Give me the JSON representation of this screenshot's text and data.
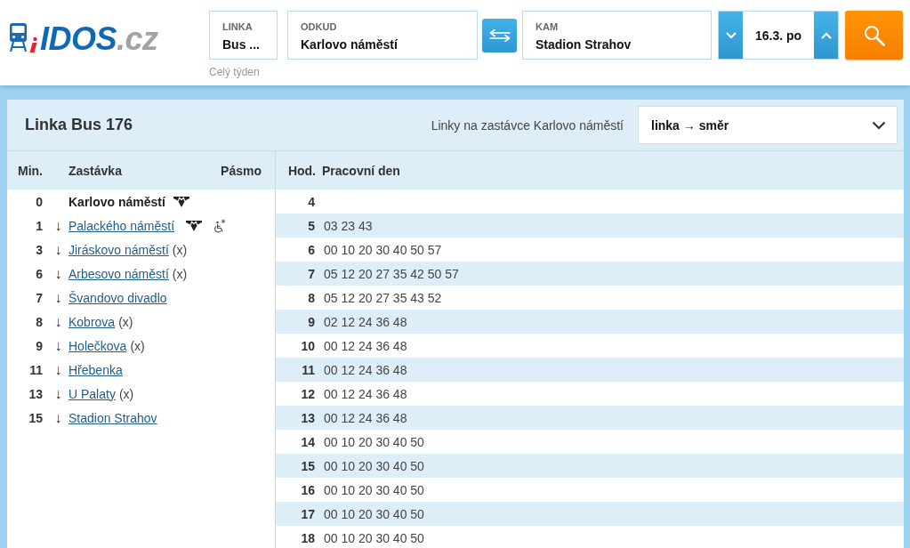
{
  "logo": {
    "name": "IDOS",
    "domain": ".cz"
  },
  "search": {
    "line": {
      "label": "LINKA",
      "value": "Bus ...",
      "note": "Celý týden"
    },
    "from": {
      "label": "ODKUD",
      "value": "Karlovo náměstí"
    },
    "to": {
      "label": "KAM",
      "value": "Stadion Strahov"
    },
    "date": "16.3. po"
  },
  "card": {
    "title": "Linka Bus 176",
    "stop_lines_label": "Linky na zastávce Karlovo náměstí",
    "select_value": "linka → směr"
  },
  "stops": {
    "columns": [
      "Min.",
      "Zastávka",
      "Pásmo"
    ],
    "rows": [
      {
        "kind": "origin",
        "min": "0",
        "name": "Karlovo náměstí",
        "metro": true,
        "wheelchair": false
      },
      {
        "kind": "link",
        "min": "1",
        "arrow": "↓",
        "name": "Palackého náměstí",
        "metro": true,
        "wheelchair": true
      },
      {
        "kind": "link",
        "min": "3",
        "arrow": "↓",
        "name": "Jiráskovo náměstí",
        "note": "(x)",
        "metro": false,
        "wheelchair": false
      },
      {
        "kind": "link",
        "min": "6",
        "arrow": "↓",
        "name": "Arbesovo náměstí",
        "note": "(x)",
        "metro": false,
        "wheelchair": false
      },
      {
        "kind": "link",
        "min": "7",
        "arrow": "↓",
        "name": "Švandovo divadlo",
        "metro": false,
        "wheelchair": false
      },
      {
        "kind": "link",
        "min": "8",
        "arrow": "↓",
        "name": "Kobrova",
        "note": "(x)",
        "metro": false,
        "wheelchair": false
      },
      {
        "kind": "link",
        "min": "9",
        "arrow": "↓",
        "name": "Holečkova",
        "note": "(x)",
        "metro": false,
        "wheelchair": false
      },
      {
        "kind": "link",
        "min": "11",
        "arrow": "↓",
        "name": "Hřebenka",
        "metro": false,
        "wheelchair": false
      },
      {
        "kind": "link",
        "min": "13",
        "arrow": "↓",
        "name": "U Palaty",
        "note": "(x)",
        "metro": false,
        "wheelchair": false
      },
      {
        "kind": "link",
        "min": "15",
        "arrow": "↓",
        "name": "Stadion Strahov",
        "metro": false,
        "wheelchair": false
      }
    ]
  },
  "timetable": {
    "columns": [
      "Hod.",
      "Pracovní den"
    ],
    "rows": [
      {
        "hour": "4"
      },
      {
        "hour": "5",
        "minutes": "03 23 43"
      },
      {
        "hour": "6",
        "minutes": "00 10 20 30 40 50 57"
      },
      {
        "hour": "7",
        "minutes": "05 12 20 27 35 42 50 57"
      },
      {
        "hour": "8",
        "minutes": "05 12 20 27 35 43 52"
      },
      {
        "hour": "9",
        "minutes": "02 12 24 36 48"
      },
      {
        "hour": "10",
        "minutes": "00 12 24 36 48"
      },
      {
        "hour": "11",
        "minutes": "00 12 24 36 48"
      },
      {
        "hour": "12",
        "minutes": "00 12 24 36 48"
      },
      {
        "hour": "13",
        "minutes": "00 12 24 36 48"
      },
      {
        "hour": "14",
        "minutes": "00 10 20 30 40 50"
      },
      {
        "hour": "15",
        "minutes": "00 10 20 30 40 50"
      },
      {
        "hour": "16",
        "minutes": "00 10 20 30 40 50"
      },
      {
        "hour": "17",
        "minutes": "00 10 20 30 40 50"
      },
      {
        "hour": "18",
        "minutes": "00 10 20 30 40 50"
      }
    ]
  }
}
